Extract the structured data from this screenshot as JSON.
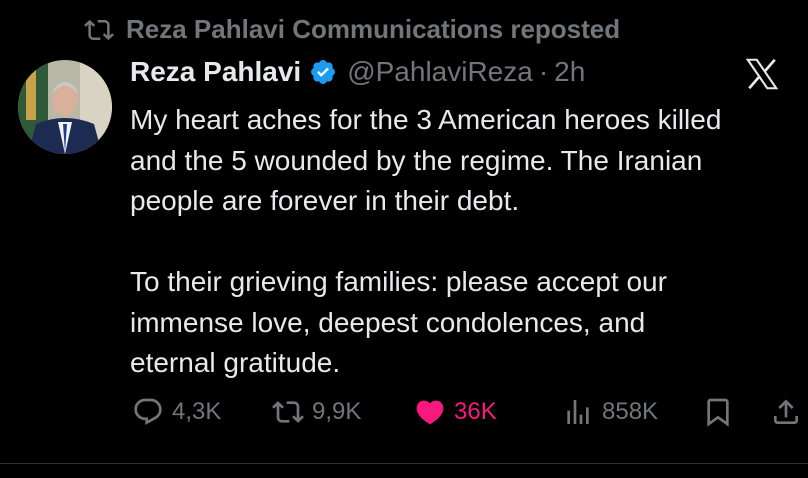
{
  "repost": {
    "text": "Reza Pahlavi Communications reposted",
    "icon": "repost-icon"
  },
  "tweet": {
    "author_name": "Reza Pahlavi",
    "verified": true,
    "handle": "@PahlaviReza",
    "separator": "·",
    "time": "2h",
    "text_lines_1": [
      "My heart aches for the 3 American heroes killed",
      "and the 5 wounded by the regime. The Iranian",
      "people are forever in their debt."
    ],
    "text_lines_2": [
      "To their grieving families: please accept our",
      "immense love, deepest condolences, and",
      "eternal gratitude."
    ]
  },
  "actions": {
    "replies": "4,3K",
    "reposts": "9,9K",
    "likes": "36K",
    "views": "858K"
  },
  "colors": {
    "background": "#000000",
    "text": "#e7e9ea",
    "secondary": "#71767b",
    "verified": "#1d9bf0",
    "like": "#f91880"
  }
}
